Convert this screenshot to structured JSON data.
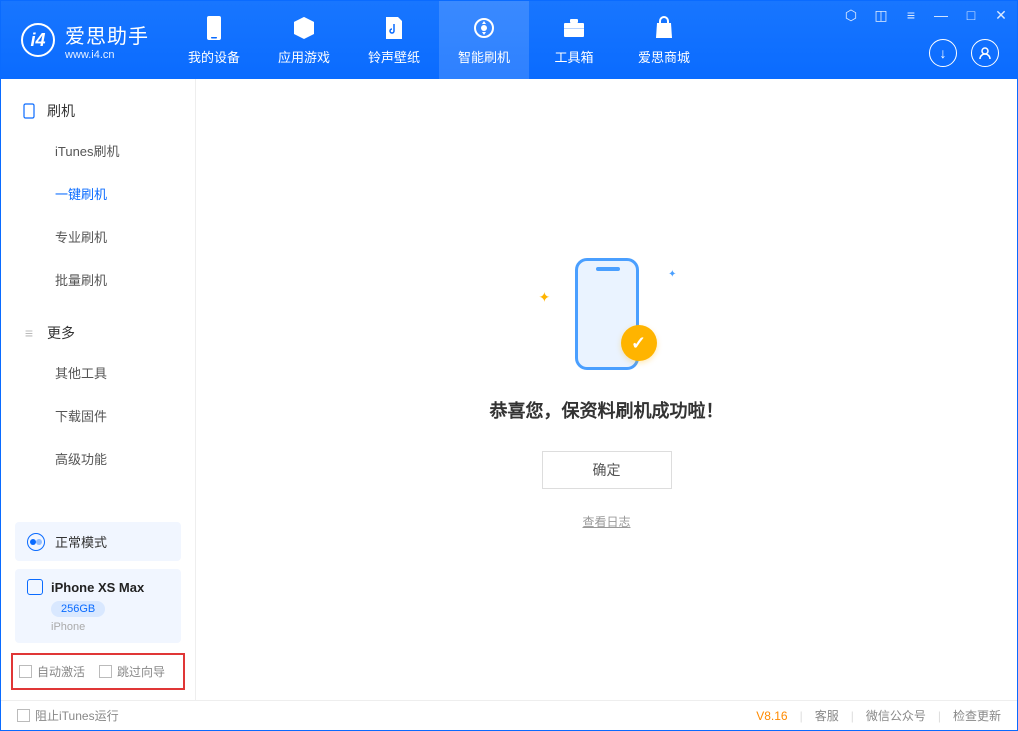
{
  "app": {
    "title": "爱思助手",
    "subtitle": "www.i4.cn"
  },
  "nav": {
    "tabs": [
      {
        "label": "我的设备"
      },
      {
        "label": "应用游戏"
      },
      {
        "label": "铃声壁纸"
      },
      {
        "label": "智能刷机"
      },
      {
        "label": "工具箱"
      },
      {
        "label": "爱思商城"
      }
    ]
  },
  "sidebar": {
    "sections": [
      {
        "title": "刷机",
        "items": [
          {
            "label": "iTunes刷机"
          },
          {
            "label": "一键刷机",
            "active": true
          },
          {
            "label": "专业刷机"
          },
          {
            "label": "批量刷机"
          }
        ]
      },
      {
        "title": "更多",
        "items": [
          {
            "label": "其他工具"
          },
          {
            "label": "下载固件"
          },
          {
            "label": "高级功能"
          }
        ]
      }
    ],
    "mode": "正常模式",
    "device": {
      "name": "iPhone XS Max",
      "storage": "256GB",
      "type": "iPhone"
    },
    "checks": {
      "autoActivate": "自动激活",
      "skipGuide": "跳过向导"
    }
  },
  "main": {
    "successMessage": "恭喜您，保资料刷机成功啦！",
    "okButton": "确定",
    "viewLog": "查看日志"
  },
  "footer": {
    "blockItunes": "阻止iTunes运行",
    "version": "V8.16",
    "links": {
      "service": "客服",
      "wechat": "微信公众号",
      "update": "检查更新"
    }
  }
}
